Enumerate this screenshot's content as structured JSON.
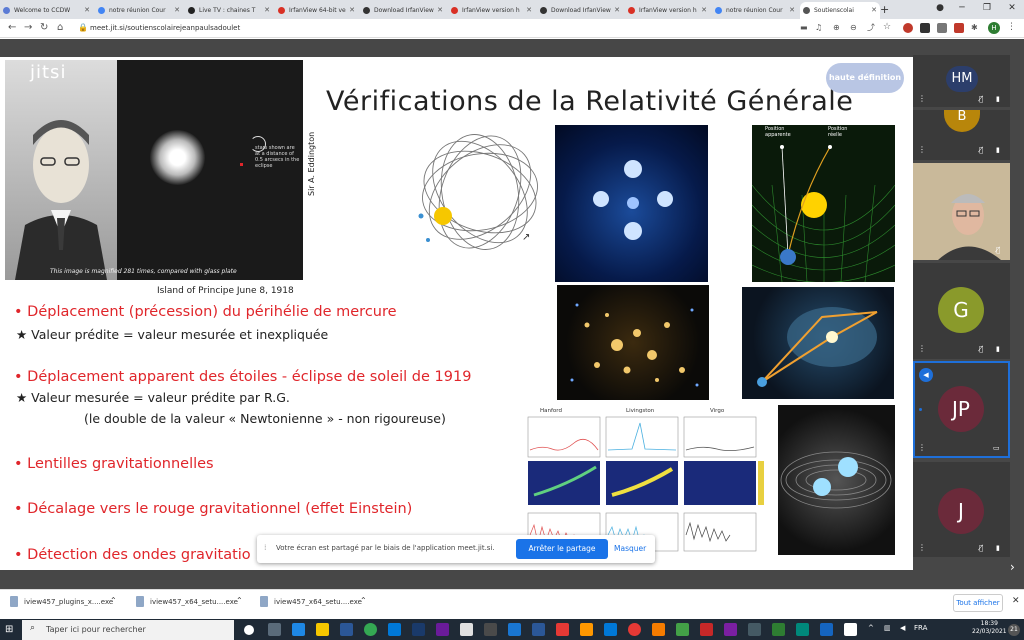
{
  "browser": {
    "tabs": [
      {
        "label": "Welcome to CCDW",
        "color": "#5b7bd5"
      },
      {
        "label": "notre réunion Cour",
        "color": "#4285f4"
      },
      {
        "label": "Live TV : chaines T",
        "color": "#222222"
      },
      {
        "label": "IrfanView 64-bit ve",
        "color": "#d93025"
      },
      {
        "label": "Download IrfanView",
        "color": "#333333"
      },
      {
        "label": "IrfanView version h",
        "color": "#d93025"
      },
      {
        "label": "Download IrfanView",
        "color": "#333333"
      },
      {
        "label": "IrfanView version h",
        "color": "#d93025"
      },
      {
        "label": "notre réunion Cour",
        "color": "#4285f4"
      },
      {
        "label": "Soutienscolai",
        "color": "#555555",
        "active": true
      }
    ],
    "new_tab": "+",
    "url": "meet.jit.si/soutienscolairejeanpaulsadoulet",
    "profile_initial": "H"
  },
  "meeting": {
    "logo": "jitsi",
    "hd_badge": "haute définition",
    "share_notice": {
      "text": "Votre écran est partagé par le biais de l'application meet.jit.si.",
      "stop_button": "Arrêter le partage",
      "hide_button": "Masquer"
    },
    "participants": [
      {
        "initials": "HM",
        "color": "#2c3e6b"
      },
      {
        "initials": "B",
        "color": "#b8860b"
      },
      {
        "initials": "",
        "color": "#777777",
        "video": true
      },
      {
        "initials": "G",
        "color": "#8a9a2b"
      },
      {
        "initials": "JP",
        "color": "#6b2a3a",
        "active": true
      },
      {
        "initials": "J",
        "color": "#6b2a3a"
      }
    ]
  },
  "slide": {
    "title": "Vérifications de la Relativité Générale",
    "photo_caption": "Island of Principe June 8, 1918",
    "photo_side": "Sir A. Eddington",
    "photo_strip": "This image is magnified   281 times, compared with glass plate",
    "photo_note": "stars shown are at a distance of 0.5 arcsecs in the eclipse",
    "bullets": [
      {
        "text": "Déplacement (précession) du périhélie de mercure",
        "sub": [
          "★ Valeur prédite = valeur mesurée et inexpliquée"
        ]
      },
      {
        "text": "Déplacement apparent des étoiles - éclipse de soleil de 1919",
        "sub": [
          "★ Valeur mesurée = valeur prédite par R.G.",
          "(le double de la valeur « Newtonienne » - non rigoureuse)"
        ]
      },
      {
        "text": "Lentilles gravitationnelles",
        "sub": []
      },
      {
        "text": "Décalage vers le rouge gravitationnel (effet Einstein)",
        "sub": []
      },
      {
        "text": "Détection des ondes gravitatio",
        "sub": []
      }
    ],
    "ligo_labels": [
      "Hanford",
      "Livingston",
      "Virgo"
    ],
    "lens_labels": [
      "Position apparente",
      "Position réelle"
    ]
  },
  "downloads": {
    "items": [
      "iview457_plugins_x....exe",
      "iview457_x64_setu....exe",
      "iview457_x64_setu....exe"
    ],
    "show_all": "Tout afficher"
  },
  "taskbar": {
    "search_placeholder": "Taper ici pour rechercher",
    "lang": "FRA",
    "time": "18:39",
    "date": "22/03/2021"
  }
}
